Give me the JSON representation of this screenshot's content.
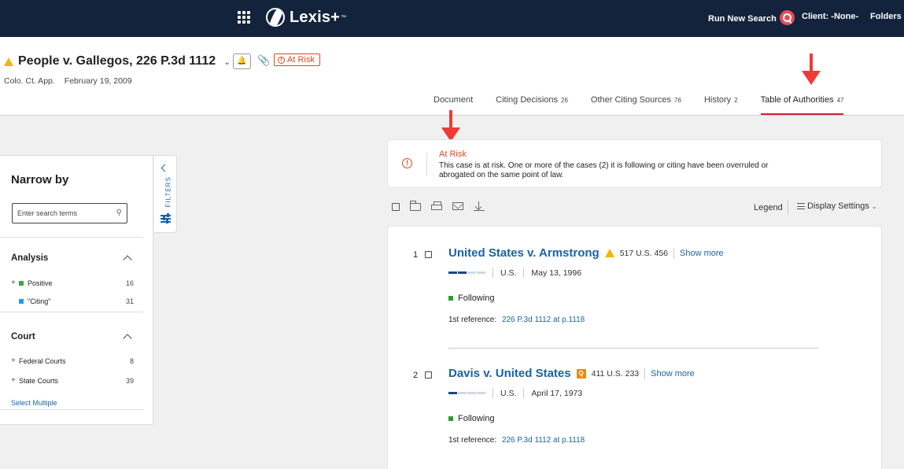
{
  "topbar": {
    "brand": "Lexis+",
    "brand_sup": "™",
    "run_new_search": "Run New Search",
    "client": "Client: -None-",
    "folders": "Folders"
  },
  "header": {
    "title": "People v. Gallegos, 226 P.3d 1112",
    "risk_badge": "At Risk",
    "court": "Colo. Ct. App.",
    "date": "February 19, 2009",
    "tabs": [
      {
        "label": "Document",
        "count": ""
      },
      {
        "label": "Citing Decisions",
        "count": "26"
      },
      {
        "label": "Other Citing Sources",
        "count": "76"
      },
      {
        "label": "History",
        "count": "2"
      },
      {
        "label": "Table of Authorities",
        "count": "47"
      }
    ]
  },
  "narrow": {
    "title": "Narrow by",
    "search_placeholder": "Enter search terms",
    "analysis": {
      "heading": "Analysis",
      "items": [
        {
          "label": "Positive",
          "count": "16",
          "color": "#3aa64a"
        },
        {
          "label": "\"Citing\"",
          "count": "31",
          "color": "#1aa0e8"
        }
      ]
    },
    "court": {
      "heading": "Court",
      "items": [
        {
          "label": "Federal Courts",
          "count": "8"
        },
        {
          "label": "State Courts",
          "count": "39"
        }
      ]
    },
    "select_multiple": "Select Multiple",
    "filters_label": "FILTERS"
  },
  "notice": {
    "title": "At Risk",
    "body": "This case is at risk. One or more of the cases (2) it is following or citing have been overruled or abrogated on the same point of law."
  },
  "toolbar": {
    "legend": "Legend",
    "display_settings": "Display Settings"
  },
  "results": [
    {
      "num": "1",
      "name": "United States v. Armstrong",
      "signal": "warning",
      "cite": "517 U.S. 456",
      "show_more": "Show more",
      "depth_bars_on": 2,
      "court": "U.S.",
      "date": "May 13, 1996",
      "treatment": "Following",
      "ref_label": "1st reference:",
      "ref_link": "226 P.3d 1112 at p.1118"
    },
    {
      "num": "2",
      "name": "Davis v. United States",
      "signal": "Q",
      "cite": "411 U.S. 233",
      "show_more": "Show more",
      "depth_bars_on": 1,
      "court": "U.S.",
      "date": "April 17, 1973",
      "treatment": "Following",
      "ref_label": "1st reference:",
      "ref_link": "226 P.3d 1112 at p.1118"
    }
  ],
  "colors": {
    "topbar": "#13233c",
    "link": "#1a63a5",
    "risk": "#d64a1c",
    "active_tab": "#d01f2e"
  }
}
